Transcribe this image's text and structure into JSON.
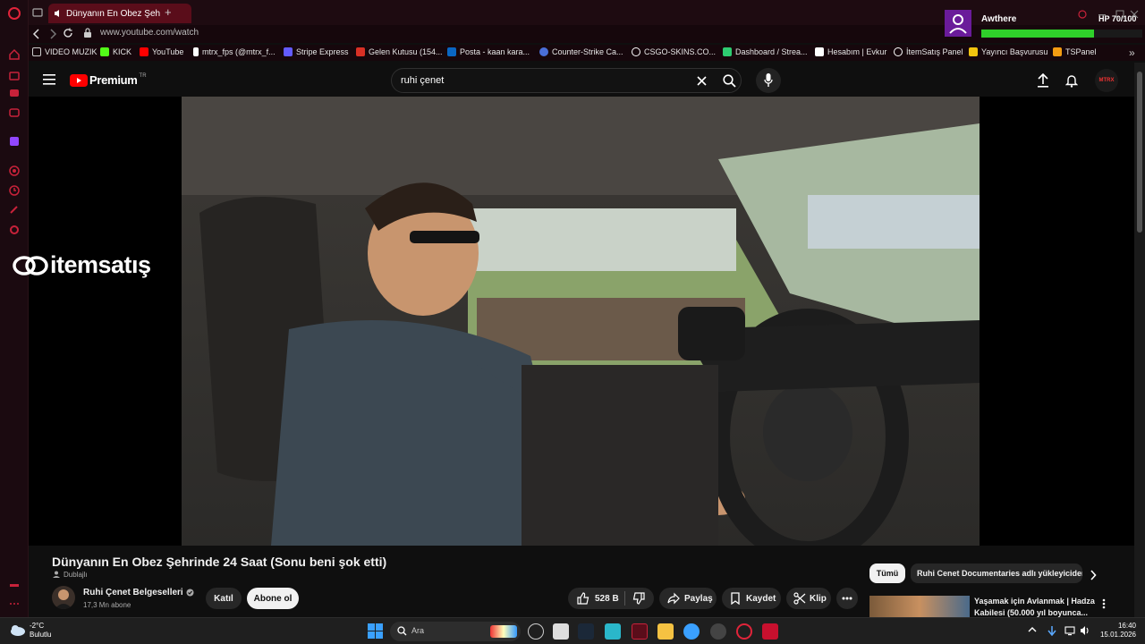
{
  "browser": {
    "tab_title": "Dünyanın En Obez Şeh",
    "url": "www.youtube.com/watch",
    "bookmarks": [
      {
        "label": "VIDEO MUZIK",
        "color": "#ccc"
      },
      {
        "label": "KICK",
        "color": "#53fc18"
      },
      {
        "label": "YouTube",
        "color": "#ff0000"
      },
      {
        "label": "mtrx_fps (@mtrx_f...",
        "color": "#ffffff"
      },
      {
        "label": "Stripe Express",
        "color": "#635bff"
      },
      {
        "label": "Gelen Kutusu (154...",
        "color": "#d93025"
      },
      {
        "label": "Posta - kaan kara...",
        "color": "#0a66c2"
      },
      {
        "label": "Counter-Strike Ca...",
        "color": "#4a6fd8"
      },
      {
        "label": "CSGO-SKINS.CO...",
        "color": "#ffffff"
      },
      {
        "label": "Dashboard / Strea...",
        "color": "#2ecc71"
      },
      {
        "label": "Hesabım | Evkur",
        "color": "#ffffff"
      },
      {
        "label": "İtemSatış Panel",
        "color": "#ffffff"
      },
      {
        "label": "Yayıncı Başvurusu",
        "color": "#f1c40f"
      },
      {
        "label": "TSPanel",
        "color": "#f39c12"
      }
    ]
  },
  "overlay": {
    "username": "Awthere",
    "hp_text": "HP 70/100",
    "hp_fraction": 0.7,
    "watermark": "itemsatış"
  },
  "youtube": {
    "logo_text": "Premium",
    "region": "TR",
    "search_query": "ruhi çenet",
    "avatar_text": "MTRX"
  },
  "video": {
    "title": "Dünyanın En Obez Şehrinde 24 Saat (Sonu beni şok etti)",
    "dub_badge": "Dublajlı",
    "channel_name": "Ruhi Çenet Belgeselleri",
    "subscribers": "17,3 Mn abone",
    "join_label": "Katıl",
    "subscribe_label": "Abone ol",
    "likes": "528 B",
    "share_label": "Paylaş",
    "save_label": "Kaydet",
    "clip_label": "Klip"
  },
  "side_panel": {
    "filter_all": "Tümü",
    "filter_channel": "Ruhi Cenet Documentaries adlı yükleyiciden",
    "next_title_line1": "Yaşamak için Avlanmak | Hadza",
    "next_title_line2": "Kabilesi (50.000 yıl boyunca..."
  },
  "taskbar": {
    "temperature": "-2°C",
    "weather": "Bulutlu",
    "search_placeholder": "Ara",
    "time": "16:40",
    "date": "15.01.2026"
  }
}
